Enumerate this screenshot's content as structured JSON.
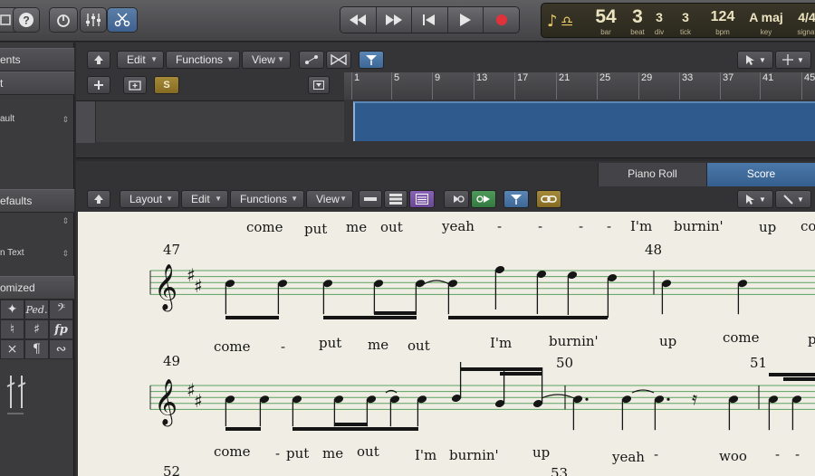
{
  "topbar": {
    "lcd": {
      "bar": "54",
      "beat": "3",
      "div": "3",
      "tick": "3",
      "bpm": "124",
      "key": "A maj",
      "signature": "4/4",
      "labels": {
        "bar": "bar",
        "beat": "beat",
        "div": "div",
        "tick": "tick",
        "bpm": "bpm",
        "key": "key",
        "signature": "signat"
      }
    }
  },
  "inspector": {
    "headers": [
      "ents",
      "t",
      "efaults",
      "omized"
    ],
    "rows": [
      "ault",
      "n Text"
    ]
  },
  "tracks": {
    "menus": {
      "edit": "Edit",
      "functions": "Functions",
      "view": "View"
    },
    "solo_label": "S",
    "ruler": [
      "1",
      "5",
      "9",
      "13",
      "17",
      "21",
      "25",
      "29",
      "33",
      "37",
      "41",
      "45"
    ]
  },
  "score_editor": {
    "tabs": {
      "piano_roll": "Piano Roll",
      "score": "Score"
    },
    "menus": {
      "layout": "Layout",
      "edit": "Edit",
      "functions": "Functions",
      "view": "View"
    },
    "measures": {
      "m47": "47",
      "m48": "48",
      "m49": "49",
      "m50": "50",
      "m51": "51",
      "m52": "52",
      "m53": "53"
    },
    "lyrics_row0": [
      "come",
      "put",
      "me",
      "out",
      "yeah",
      "-",
      "-",
      "-",
      "-",
      "I'm",
      "burnin'",
      "up",
      "co"
    ],
    "lyrics_row1": [
      "come",
      "-",
      "put",
      "me",
      "out",
      "I'm",
      "burnin'",
      "up",
      "come",
      "p"
    ],
    "lyrics_row2": [
      "come",
      "-",
      "put",
      "me",
      "out",
      "I'm",
      "burnin'",
      "up",
      "yeah",
      "-",
      "woo",
      "-",
      "-"
    ]
  },
  "colors": {
    "lcd_bg": "#2b281e",
    "region": "#2e5a8e",
    "score_tab_active": "#4b78aa",
    "paper": "#f0eee4",
    "staff_line": "#5aa060"
  }
}
